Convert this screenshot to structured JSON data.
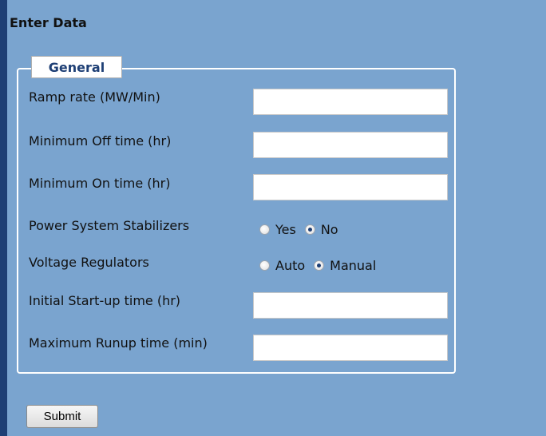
{
  "page": {
    "title": "Enter Data"
  },
  "general": {
    "legend": "General",
    "ramp_rate": {
      "label": "Ramp rate (MW/Min)",
      "value": ""
    },
    "min_off_time": {
      "label": "Minimum Off time (hr)",
      "value": ""
    },
    "min_on_time": {
      "label": "Minimum On time (hr)",
      "value": ""
    },
    "pss": {
      "label": "Power System Stabilizers",
      "options": [
        "Yes",
        "No"
      ],
      "selected": "No"
    },
    "voltage_regulators": {
      "label": "Voltage Regulators",
      "options": [
        "Auto",
        "Manual"
      ],
      "selected": "Manual"
    },
    "initial_startup_time": {
      "label": "Initial Start-up time (hr)",
      "value": ""
    },
    "max_runup_time": {
      "label": "Maximum Runup time (min)",
      "value": ""
    }
  },
  "actions": {
    "submit_label": "Submit"
  },
  "colors": {
    "background": "#7aa4cf",
    "accent": "#1e3f75",
    "group_border": "#ffffff"
  }
}
